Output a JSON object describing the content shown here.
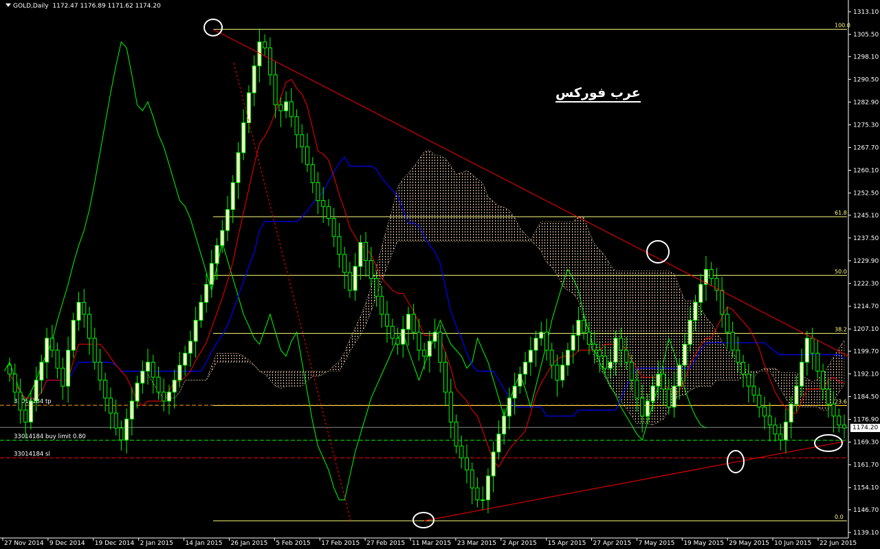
{
  "header": {
    "symbol": "GOLD,Daily",
    "ohlc": "1172.47 1176.89 1171.62 1174.20"
  },
  "watermark": "عرب فوركس",
  "current_price_label": "1174.20",
  "orders": {
    "tp": "33014184 tp",
    "buy_limit": "33014184 buy limit 0.80",
    "sl": "33014184 sl"
  },
  "colors": {
    "background": "#000000",
    "candle_bull": "#ffffcc",
    "candle_outline": "#00ff00",
    "fib_line": "#ffff80",
    "trendline": "#ff0000",
    "tenkan": "#ff0000",
    "kijun": "#0000ff",
    "chikou": "#00ff00",
    "tp_line": "#ffa500",
    "buy_limit_line": "#00ff00",
    "sl_line": "#ff0000"
  },
  "chart_data": {
    "type": "candlestick",
    "instrument": "GOLD",
    "timeframe": "Daily",
    "ylim": [
      1139.1,
      1313.1
    ],
    "y_ticks": [
      "1313.10",
      "1305.50",
      "1298.10",
      "1290.50",
      "1282.90",
      "1275.30",
      "1267.70",
      "1260.10",
      "1252.50",
      "1245.10",
      "1237.50",
      "1229.90",
      "1222.30",
      "1214.70",
      "1207.10",
      "1199.70",
      "1192.10",
      "1184.50",
      "1176.90",
      "1169.30",
      "1161.70",
      "1154.10",
      "1146.70",
      "1139.10"
    ],
    "x_ticks": [
      "27 Nov 2014",
      "9 Dec 2014",
      "19 Dec 2014",
      "2 Jan 2015",
      "14 Jan 2015",
      "26 Jan 2015",
      "5 Feb 2015",
      "17 Feb 2015",
      "27 Feb 2015",
      "11 Mar 2015",
      "23 Mar 2015",
      "2 Apr 2015",
      "15 Apr 2015",
      "27 Apr 2015",
      "7 May 2015",
      "19 May 2015",
      "29 May 2015",
      "10 Jun 2015",
      "22 Jun 2015"
    ],
    "fibonacci_levels": [
      {
        "label": "100.0",
        "price": 1307.2
      },
      {
        "label": "61.8",
        "price": 1244.6
      },
      {
        "label": "50.0",
        "price": 1225.0
      },
      {
        "label": "38.2",
        "price": 1205.6
      },
      {
        "label": "23.6",
        "price": 1181.5
      },
      {
        "label": "0.0",
        "price": 1143.0
      }
    ],
    "order_levels": [
      {
        "name": "tp",
        "price": 1181.6
      },
      {
        "name": "buy limit",
        "price": 1169.9
      },
      {
        "name": "sl",
        "price": 1164.0
      }
    ],
    "last_price": 1174.2,
    "closes": [
      1192,
      1186,
      1180,
      1176,
      1183,
      1190,
      1196,
      1204,
      1200,
      1194,
      1188,
      1200,
      1210,
      1216,
      1212,
      1204,
      1196,
      1190,
      1184,
      1179,
      1174,
      1170,
      1177,
      1183,
      1189,
      1193,
      1196,
      1191,
      1186,
      1183,
      1186,
      1190,
      1195,
      1199,
      1203,
      1210,
      1216,
      1222,
      1229,
      1235,
      1240,
      1247,
      1256,
      1266,
      1276,
      1286,
      1295,
      1303,
      1301,
      1292,
      1282,
      1280,
      1283,
      1278,
      1272,
      1268,
      1262,
      1256,
      1250,
      1248,
      1244,
      1238,
      1232,
      1226,
      1220,
      1228,
      1236,
      1230,
      1224,
      1218,
      1212,
      1208,
      1204,
      1202,
      1207,
      1212,
      1206,
      1200,
      1198,
      1203,
      1206,
      1196,
      1186,
      1176,
      1168,
      1164,
      1160,
      1154,
      1150,
      1150,
      1158,
      1166,
      1172,
      1178,
      1184,
      1188,
      1192,
      1196,
      1200,
      1204,
      1206,
      1200,
      1195,
      1190,
      1195,
      1200,
      1205,
      1210,
      1206,
      1202,
      1200,
      1198,
      1194,
      1196,
      1204,
      1200,
      1196,
      1190,
      1184,
      1178,
      1183,
      1188,
      1192,
      1187,
      1181,
      1188,
      1195,
      1202,
      1210,
      1216,
      1222,
      1227,
      1224,
      1220,
      1212,
      1206,
      1200,
      1196,
      1192,
      1188,
      1185,
      1181,
      1178,
      1175,
      1172,
      1170,
      1176,
      1182,
      1188,
      1196,
      1204,
      1199,
      1193,
      1187,
      1182,
      1178,
      1175,
      1174
    ]
  }
}
